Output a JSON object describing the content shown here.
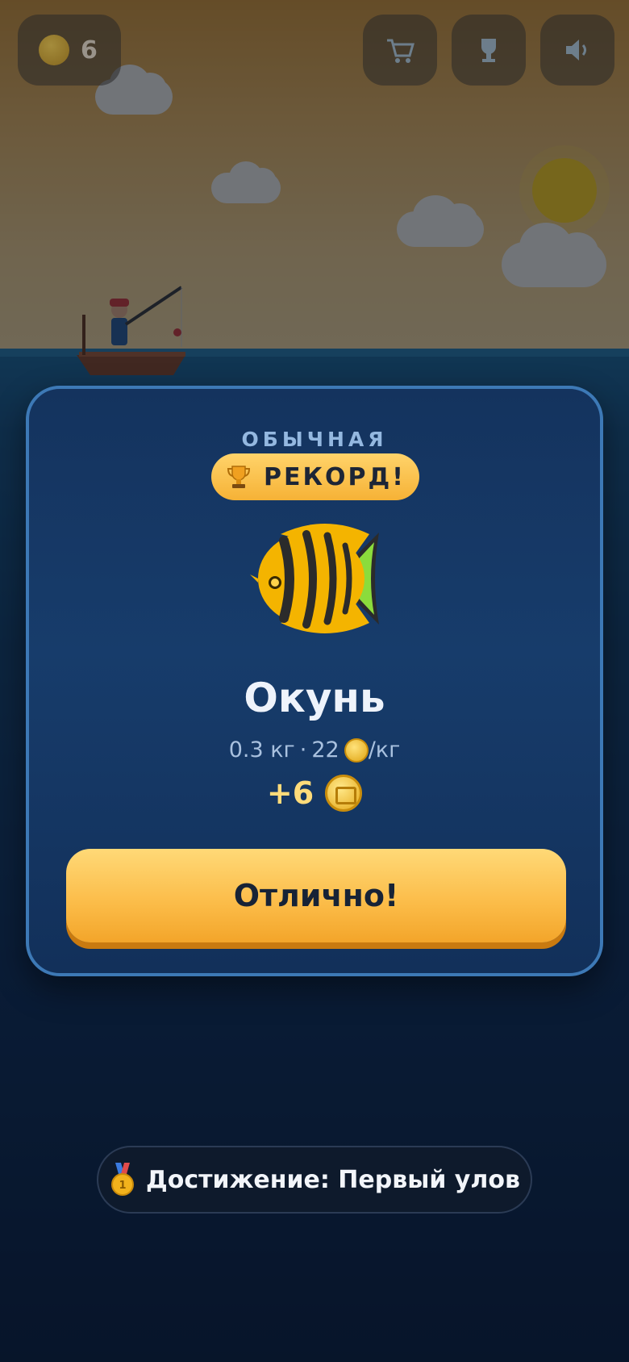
{
  "hud": {
    "coins": "6",
    "icons": [
      "coin-icon",
      "cart-icon",
      "trophy-icon",
      "speaker-icon"
    ]
  },
  "catch_modal": {
    "rarity": "ОБЫЧНАЯ",
    "record_badge": "РЕКОРД!",
    "fish_icon": "yellow-striped-fish",
    "fish_name": "Окунь",
    "weight": "0.3 кг",
    "separator": "·",
    "price": "22",
    "price_unit": "/кг",
    "reward": "+6",
    "confirm_label": "Отлично!"
  },
  "toast": {
    "icon": "medal-icon",
    "text": "Достижение: Первый улов"
  },
  "colors": {
    "accent": "#fbbb47",
    "card_border": "#3d79b6",
    "card_bg": "#173c6b",
    "reward_text": "#ffdb7a",
    "rarity_text": "#94b8e0"
  }
}
